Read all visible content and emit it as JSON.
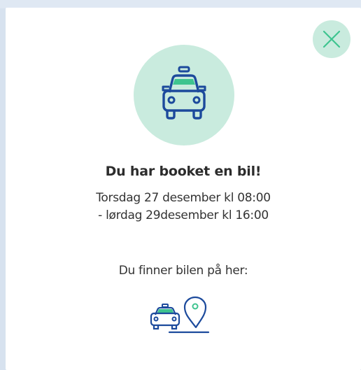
{
  "modal": {
    "title": "Du har booket en bil!",
    "date_line_1": "Torsdag 27 desember kl 08:00",
    "date_line_2": "- lørdag 29desember kl 16:00",
    "location_label": "Du finner bilen på her:"
  },
  "icons": {
    "close": "close-icon",
    "hero": "taxi-car-icon",
    "location": "car-location-pin-icon"
  },
  "colors": {
    "accent_light": "#c9ebde",
    "accent_green": "#3ec48f",
    "icon_blue": "#1c4a9c",
    "text": "#2c2c2c"
  }
}
